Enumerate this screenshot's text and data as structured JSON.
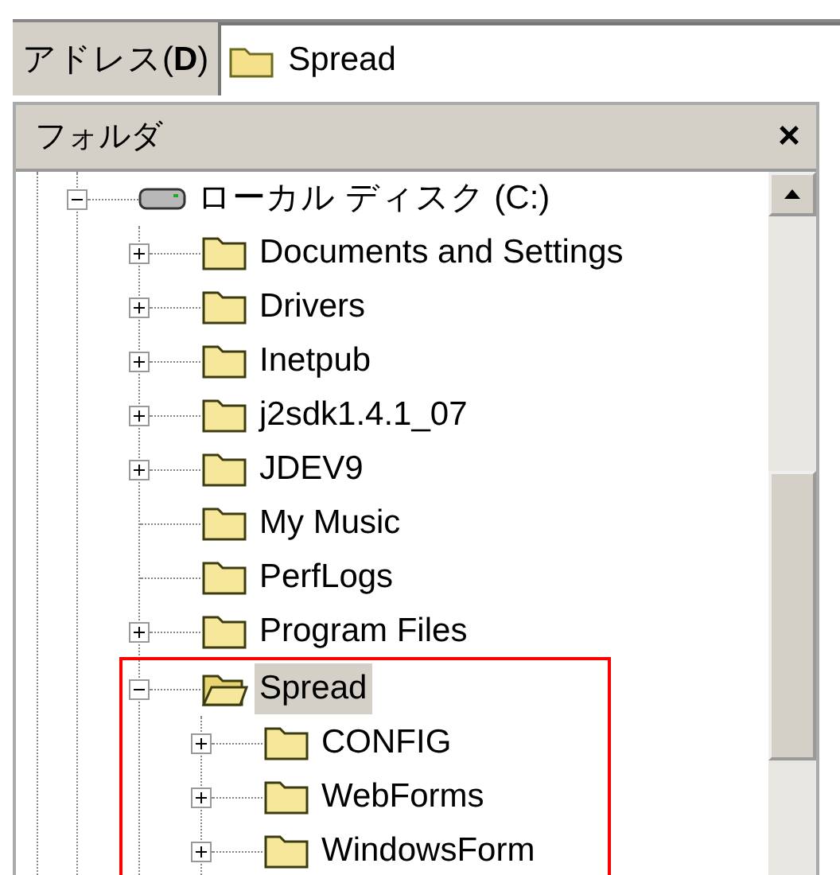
{
  "address_bar": {
    "label": "アドレス(**D**)",
    "value": "Spread"
  },
  "folder_pane": {
    "title": "フォルダ",
    "close": "×"
  },
  "tree": [
    {
      "kind": "drive",
      "label": "ローカル ディスク (C:)",
      "expandable": true,
      "expanded": true,
      "selected": false,
      "highlighted": false,
      "children": [
        {
          "kind": "folder",
          "label": "Documents and Settings",
          "expandable": true,
          "expanded": false,
          "selected": false,
          "highlighted": false
        },
        {
          "kind": "folder",
          "label": "Drivers",
          "expandable": true,
          "expanded": false,
          "selected": false,
          "highlighted": false
        },
        {
          "kind": "folder",
          "label": "Inetpub",
          "expandable": true,
          "expanded": false,
          "selected": false,
          "highlighted": false
        },
        {
          "kind": "folder",
          "label": "j2sdk1.4.1_07",
          "expandable": true,
          "expanded": false,
          "selected": false,
          "highlighted": false
        },
        {
          "kind": "folder",
          "label": "JDEV9",
          "expandable": true,
          "expanded": false,
          "selected": false,
          "highlighted": false
        },
        {
          "kind": "folder",
          "label": "My Music",
          "expandable": false,
          "expanded": false,
          "selected": false,
          "highlighted": false
        },
        {
          "kind": "folder",
          "label": "PerfLogs",
          "expandable": false,
          "expanded": false,
          "selected": false,
          "highlighted": false
        },
        {
          "kind": "folder",
          "label": "Program Files",
          "expandable": true,
          "expanded": false,
          "selected": false,
          "highlighted": false
        },
        {
          "kind": "folder",
          "label": "Spread",
          "expandable": true,
          "expanded": true,
          "selected": true,
          "highlighted": true,
          "children": [
            {
              "kind": "folder",
              "label": "CONFIG",
              "expandable": true,
              "expanded": false,
              "selected": false,
              "highlighted": false
            },
            {
              "kind": "folder",
              "label": "WebForms",
              "expandable": true,
              "expanded": false,
              "selected": false,
              "highlighted": false
            },
            {
              "kind": "folder",
              "label": "WindowsForm",
              "expandable": true,
              "expanded": false,
              "selected": false,
              "highlighted": false
            }
          ]
        }
      ]
    }
  ]
}
